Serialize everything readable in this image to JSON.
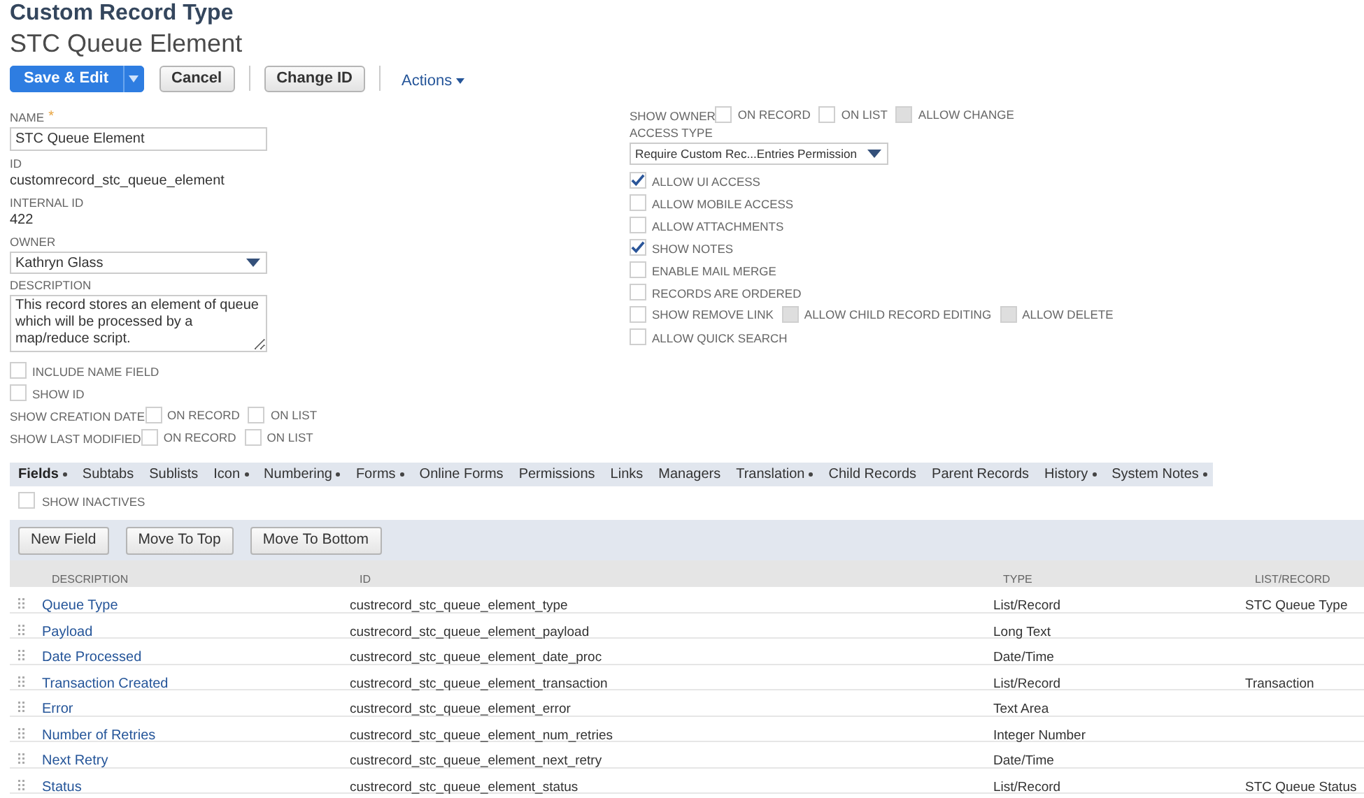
{
  "header": {
    "title": "Custom Record Type",
    "record_name": "STC Queue Element"
  },
  "toolbar": {
    "buttons": [
      {
        "label": "Save & Edit",
        "kind": "primary"
      },
      {
        "label": "Cancel",
        "kind": "plain"
      },
      {
        "label": "Change ID",
        "kind": "plain"
      }
    ],
    "actions": "Actions"
  },
  "left_fields": [
    {
      "kind": "input",
      "label": "NAME",
      "required_mark": "*",
      "value": "STC Queue Element"
    },
    {
      "kind": "readonly",
      "label": "ID",
      "value": "customrecord_stc_queue_element"
    },
    {
      "kind": "readonly",
      "label": "INTERNAL ID",
      "value": "422"
    },
    {
      "kind": "select",
      "label": "OWNER",
      "value": "Kathryn Glass"
    },
    {
      "kind": "textarea",
      "label": "DESCRIPTION",
      "value": "This record stores an element of queue which will be processed by a map/reduce script."
    },
    {
      "kind": "checkbox",
      "label": "INCLUDE NAME FIELD",
      "checked": false,
      "disabled": false
    },
    {
      "kind": "checkbox",
      "label": "SHOW ID",
      "checked": false,
      "disabled": false
    },
    {
      "kind": "checkbox_row",
      "label": "SHOW CREATION DATE",
      "options": [
        {
          "label": "ON RECORD",
          "checked": false,
          "disabled": false
        },
        {
          "label": "ON LIST",
          "checked": false,
          "disabled": false
        }
      ]
    },
    {
      "kind": "checkbox_row",
      "label": "SHOW LAST MODIFIED",
      "options": [
        {
          "label": "ON RECORD",
          "checked": false,
          "disabled": false
        },
        {
          "label": "ON LIST",
          "checked": false,
          "disabled": false
        }
      ]
    }
  ],
  "right_fields": [
    {
      "kind": "checkbox_row",
      "label": "SHOW OWNER",
      "options": [
        {
          "label": "ON RECORD",
          "checked": false,
          "disabled": false
        },
        {
          "label": "ON LIST",
          "checked": false,
          "disabled": false
        },
        {
          "label": "ALLOW CHANGE",
          "checked": false,
          "disabled": true
        }
      ]
    },
    {
      "kind": "select",
      "label": "ACCESS TYPE",
      "value": "Require Custom Rec...Entries Permission"
    },
    {
      "kind": "checkbox",
      "label": "ALLOW UI ACCESS",
      "checked": true,
      "disabled": false
    },
    {
      "kind": "checkbox",
      "label": "ALLOW MOBILE ACCESS",
      "checked": false,
      "disabled": false
    },
    {
      "kind": "checkbox",
      "label": "ALLOW ATTACHMENTS",
      "checked": false,
      "disabled": false
    },
    {
      "kind": "checkbox",
      "label": "SHOW NOTES",
      "checked": true,
      "disabled": false
    },
    {
      "kind": "checkbox",
      "label": "ENABLE MAIL MERGE",
      "checked": false,
      "disabled": false
    },
    {
      "kind": "checkbox",
      "label": "RECORDS ARE ORDERED",
      "checked": false,
      "disabled": false
    },
    {
      "kind": "checkbox_row",
      "options": [
        {
          "label": "SHOW REMOVE LINK",
          "checked": false,
          "disabled": false
        },
        {
          "label": "ALLOW CHILD RECORD EDITING",
          "checked": false,
          "disabled": true
        },
        {
          "label": "ALLOW DELETE",
          "checked": false,
          "disabled": true
        }
      ]
    },
    {
      "kind": "checkbox",
      "label": "ALLOW QUICK SEARCH",
      "checked": false,
      "disabled": false
    }
  ],
  "tabs": [
    {
      "label": "Fields",
      "selected": true,
      "has_content": true
    },
    {
      "label": "Subtabs",
      "selected": false,
      "has_content": false
    },
    {
      "label": "Sublists",
      "selected": false,
      "has_content": false
    },
    {
      "label": "Icon",
      "selected": false,
      "has_content": true
    },
    {
      "label": "Numbering",
      "selected": false,
      "has_content": true
    },
    {
      "label": "Forms",
      "selected": false,
      "has_content": true
    },
    {
      "label": "Online Forms",
      "selected": false,
      "has_content": false
    },
    {
      "label": "Permissions",
      "selected": false,
      "has_content": false
    },
    {
      "label": "Links",
      "selected": false,
      "has_content": false
    },
    {
      "label": "Managers",
      "selected": false,
      "has_content": false
    },
    {
      "label": "Translation",
      "selected": false,
      "has_content": true
    },
    {
      "label": "Child Records",
      "selected": false,
      "has_content": false
    },
    {
      "label": "Parent Records",
      "selected": false,
      "has_content": false
    },
    {
      "label": "History",
      "selected": false,
      "has_content": true
    },
    {
      "label": "System Notes",
      "selected": false,
      "has_content": true
    }
  ],
  "show_inactives": {
    "label": "SHOW INACTIVES",
    "checked": false
  },
  "sublist_buttons": [
    "New Field",
    "Move To Top",
    "Move To Bottom"
  ],
  "table": {
    "columns": [
      "DESCRIPTION",
      "ID",
      "TYPE",
      "LIST/RECORD"
    ],
    "rows": [
      [
        "Queue Type",
        "custrecord_stc_queue_element_type",
        "List/Record",
        "STC Queue Type"
      ],
      [
        "Payload",
        "custrecord_stc_queue_element_payload",
        "Long Text",
        ""
      ],
      [
        "Date Processed",
        "custrecord_stc_queue_element_date_proc",
        "Date/Time",
        ""
      ],
      [
        "Transaction Created",
        "custrecord_stc_queue_element_transaction",
        "List/Record",
        "Transaction"
      ],
      [
        "Error",
        "custrecord_stc_queue_element_error",
        "Text Area",
        ""
      ],
      [
        "Number of Retries",
        "custrecord_stc_queue_element_num_retries",
        "Integer Number",
        ""
      ],
      [
        "Next Retry",
        "custrecord_stc_queue_element_next_retry",
        "Date/Time",
        ""
      ],
      [
        "Status",
        "custrecord_stc_queue_element_status",
        "List/Record",
        "STC Queue Status"
      ]
    ]
  }
}
